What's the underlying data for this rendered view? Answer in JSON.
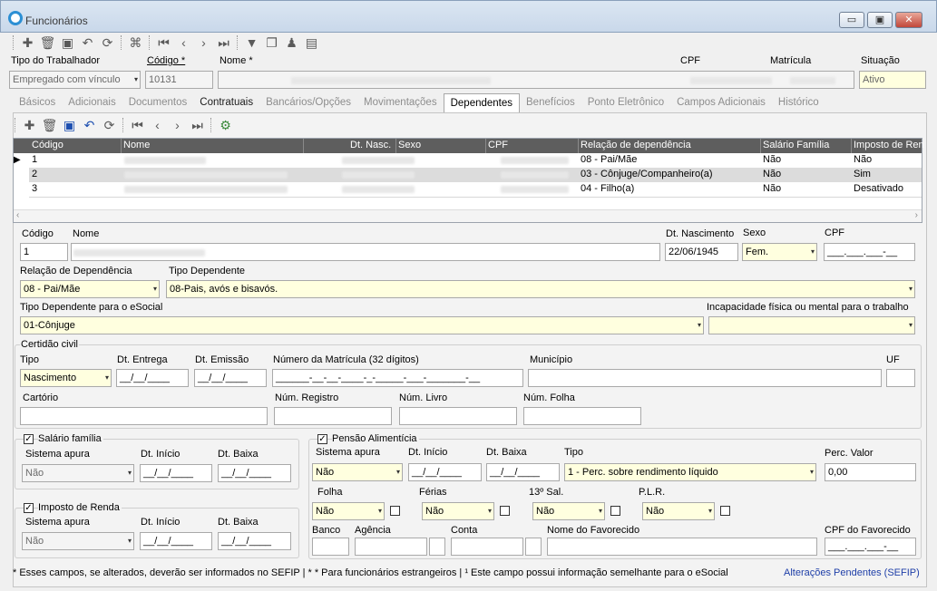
{
  "window": {
    "title": "Funcionários",
    "btn_min": "▭",
    "btn_max": "▣",
    "btn_close": "✕"
  },
  "toolbar_icons": [
    "add-icon",
    "delete-icon",
    "save-icon",
    "undo-icon",
    "refresh-icon",
    "binoculars-icon",
    "first-icon",
    "prev-icon",
    "next-icon",
    "last-icon",
    "filter-icon",
    "copy-icon",
    "user-icon",
    "report-icon"
  ],
  "header": {
    "tipo_label": "Tipo do Trabalhador",
    "tipo_value": "Empregado com vínculo",
    "codigo_label": "Código *",
    "codigo_value": "10131",
    "nome_label": "Nome *",
    "cpf_label": "CPF",
    "matricula_label": "Matrícula",
    "situacao_label": "Situação",
    "situacao_value": "Ativo"
  },
  "tabs": [
    "Básicos",
    "Adicionais",
    "Documentos",
    "Contratuais",
    "Bancários/Opções",
    "Movimentações",
    "Dependentes",
    "Benefícios",
    "Ponto Eletrônico",
    "Campos Adicionais",
    "Histórico"
  ],
  "grid": {
    "columns": [
      "Código",
      "Nome",
      "Dt. Nasc.",
      "Sexo",
      "CPF",
      "Relação de dependência",
      "Salário Família",
      "Imposto de Ren"
    ],
    "rows": [
      {
        "codigo": "1",
        "relacao": "08 - Pai/Mãe",
        "salario": "Não",
        "imposto": "Não"
      },
      {
        "codigo": "2",
        "relacao": "03 - Cônjuge/Companheiro(a)",
        "salario": "Não",
        "imposto": "Sim"
      },
      {
        "codigo": "3",
        "relacao": "04 - Filho(a)",
        "salario": "Não",
        "imposto": "Desativado"
      }
    ]
  },
  "form": {
    "codigo_label": "Código",
    "codigo_value": "1",
    "nome_label": "Nome",
    "dtnasc_label": "Dt. Nascimento",
    "dtnasc_value": "22/06/1945",
    "sexo_label": "Sexo",
    "sexo_value": "Fem.",
    "cpf_label": "CPF",
    "cpf_mask": "___.___.___-__",
    "relacao_label": "Relação de Dependência",
    "relacao_value": "08 - Pai/Mãe",
    "tipodep_label": "Tipo Dependente",
    "tipodep_value": "08-Pais, avós e bisavós.",
    "tipodep_esocial_label": "Tipo Dependente para o eSocial",
    "tipodep_esocial_value": "01-Cônjuge",
    "incap_label": "Incapacidade física ou mental para o trabalho"
  },
  "certidao": {
    "title": "Certidão civil",
    "tipo_label": "Tipo",
    "tipo_value": "Nascimento",
    "dtentrega_label": "Dt. Entrega",
    "dtemissao_label": "Dt. Emissão",
    "matricula_label": "Número da Matrícula (32 dígitos)",
    "matricula_mask": "______-__-__-____-_-_____-___-_______-__",
    "municipio_label": "Município",
    "uf_label": "UF",
    "cartorio_label": "Cartório",
    "registro_label": "Núm. Registro",
    "livro_label": "Núm. Livro",
    "folha_label": "Núm. Folha",
    "date_mask": "__/__/____"
  },
  "salario_familia": {
    "title": "Salário família",
    "sistema_label": "Sistema apura",
    "sistema_value": "Não",
    "inicio_label": "Dt. Início",
    "baixa_label": "Dt. Baixa"
  },
  "imposto_renda": {
    "title": "Imposto de Renda",
    "sistema_label": "Sistema apura",
    "sistema_value": "Não",
    "inicio_label": "Dt. Início",
    "baixa_label": "Dt. Baixa"
  },
  "pensao": {
    "title": "Pensão Alimentícia",
    "sistema_label": "Sistema apura",
    "sistema_value": "Não",
    "inicio_label": "Dt. Início",
    "baixa_label": "Dt. Baixa",
    "tipo_label": "Tipo",
    "tipo_value": "1 - Perc. sobre rendimento líquido",
    "perc_label": "Perc. Valor",
    "perc_value": "0,00",
    "folha_label": "Folha",
    "folha_value": "Não",
    "ferias_label": "Férias",
    "ferias_value": "Não",
    "sal13_label": "13º Sal.",
    "sal13_value": "Não",
    "plr_label": "P.L.R.",
    "plr_value": "Não",
    "banco_label": "Banco",
    "agencia_label": "Agência",
    "conta_label": "Conta",
    "favorecido_label": "Nome do Favorecido",
    "cpf_fav_label": "CPF do Favorecido",
    "cpf_mask": "___.___.___-__"
  },
  "footer": {
    "note": "* Esses campos, se alterados, deverão ser informados no SEFIP | * * Para funcionários estrangeiros |  ¹  Este campo possui informação semelhante para o eSocial",
    "link": "Alterações Pendentes (SEFIP)"
  }
}
